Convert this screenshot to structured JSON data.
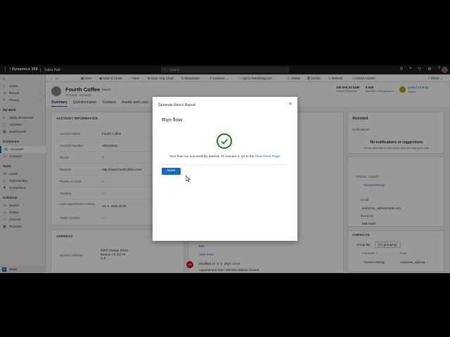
{
  "topbar": {
    "app_name": "Dynamics 365",
    "hub": "Sales Hub",
    "search_placeholder": "Search"
  },
  "nav": {
    "home": "Home",
    "recent": "Recent",
    "pinned": "Pinned",
    "my_work": "My Work",
    "sales_accelerator": "Sales accelerator",
    "activities": "Activities",
    "dashboards": "Dashboards",
    "customers": "Customers",
    "accounts": "Accounts",
    "contacts": "Contacts",
    "sales": "Sales",
    "leads": "Leads",
    "opportunities": "Opportunities",
    "competitors": "Competitors",
    "collateral": "Collateral",
    "quotes": "Quotes",
    "orders": "Orders",
    "invoices": "Invoices",
    "products": "Products",
    "area_badge": "S",
    "area": "Sales"
  },
  "commands": {
    "save": "Save",
    "save_close": "Save & Close",
    "new": "New",
    "open_org_chart": "Open Org Chart",
    "deactivate": "Deactivate",
    "connect": "Connect",
    "add_marketing": "Add to Marketing List",
    "assign": "Assign",
    "delete": "Delete",
    "refresh": "Refresh",
    "check_access": "Check Access",
    "share": "Share"
  },
  "record": {
    "name": "Fourth Coffee",
    "saved": "- Saved",
    "type": "Account · Account",
    "revenue": "100 000,00 EUR",
    "revenue_label": "Annual Revenue",
    "employees": "9 500",
    "employees_label": "Number of Employees",
    "owner": "Daniel Smerdy",
    "owner_label": "Owner",
    "tabs": [
      "Summary",
      "Questionnaires",
      "Contacts",
      "Assets and Loca"
    ]
  },
  "account_info": {
    "title": "ACCOUNT INFORMATION",
    "fields": [
      {
        "label": "Account Name",
        "value": "Fourth Coffee"
      },
      {
        "label": "Account Number",
        "value": "ABSS4545"
      },
      {
        "label": "Phone",
        "value": "7"
      },
      {
        "label": "Website",
        "value": "http://www.fourthcoffee.com/"
      },
      {
        "label": "Parent Account",
        "value": "---"
      },
      {
        "label": "Territory",
        "value": "---"
      },
      {
        "label": "Last Appointment Activity",
        "value": "13. 5. 2020     10:31"
      },
      {
        "label": "Ticker Symbol",
        "value": "---"
      }
    ]
  },
  "address": {
    "title": "ADDRESS",
    "label": "Service Address",
    "line1": "5009 Orange Street",
    "line2": "Renton TX 20175",
    "line3": "U.S."
  },
  "timeline": {
    "text1": "test",
    "view_more1": "View more",
    "modified": "Modified on: 6. 3. 2020 10:04",
    "appt": "Appointment from: Miroslav Matras  Closed",
    "view_more2": "View more",
    "avatar": "MM"
  },
  "assistant": {
    "title": "Assistant",
    "notifications": "Notifications",
    "empty_title": "No notifications or suggestions",
    "empty_text": "Check back later to see what's new and stay up to date"
  },
  "primary_contact": {
    "label": "Primary Contact",
    "name": "Yvonne McKay",
    "email_label": "Email",
    "email": "someone_a@example.com",
    "business_label": "Business",
    "phone": "555-0100"
  },
  "contacts_panel": {
    "title": "CONTACTS",
    "group_by": "Group By:",
    "group_value": "(no grouping)",
    "col1": "Full Name ↑",
    "col2": "Email",
    "row_name": "Yvonne McKay",
    "row_email": "someone_a@exa..."
  },
  "dialog": {
    "header": "Generate Resco Report",
    "title": "Run flow",
    "message": "Your flow run successfully started. To monitor it, go to the ",
    "link": "Flow Runs Page",
    "message_end": ".",
    "done": "Done"
  }
}
